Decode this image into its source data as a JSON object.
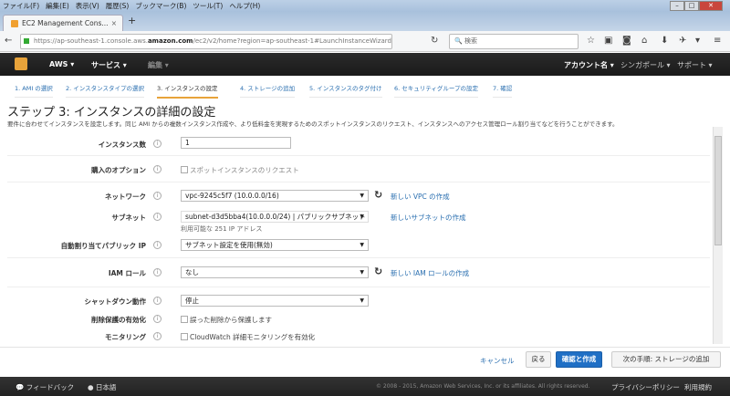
{
  "browser": {
    "menu": [
      "ファイル(F)",
      "編集(E)",
      "表示(V)",
      "履歴(S)",
      "ブックマーク(B)",
      "ツール(T)",
      "ヘルプ(H)"
    ],
    "tab_title": "EC2 Management Cons...",
    "url_prefix": "https://ap-southeast-1.console.aws.",
    "url_domain": "amazon.com",
    "url_suffix": "/ec2/v2/home?region=ap-southeast-1#LaunchInstanceWizard:",
    "search_placeholder": "検索"
  },
  "aws_nav": {
    "aws": "AWS ▾",
    "services": "サービス ▾",
    "edit": "編集 ▾",
    "account": "アカウント名 ▾",
    "region": "シンガポール ▾",
    "support": "サポート ▾"
  },
  "steps": [
    "1. AMI の選択",
    "2. インスタンスタイプの選択",
    "3. インスタンスの設定",
    "4. ストレージの追加",
    "5. インスタンスのタグ付け",
    "6. セキュリティグループの設定",
    "7. 確認"
  ],
  "page": {
    "title": "ステップ 3: インスタンスの詳細の設定",
    "description": "要件に合わせてインスタンスを設定します。同じ AMI からの複数インスタンス作成や、より低料金を実現するためのスポットインスタンスのリクエスト、インスタンスへのアクセス管理ロール割り当てなどを行うことができます。"
  },
  "form": {
    "instance_count": {
      "label": "インスタンス数",
      "value": "1"
    },
    "purchase": {
      "label": "購入のオプション",
      "checkbox": "スポットインスタンスのリクエスト",
      "checked": false
    },
    "network": {
      "label": "ネットワーク",
      "value": "vpc-9245c5f7 (10.0.0.0/16)",
      "link": "新しい VPC の作成"
    },
    "subnet": {
      "label": "サブネット",
      "value": "subnet-d3d5bba4(10.0.0.0/24) | パブリックサブネット",
      "note": "利用可能な 251 IP アドレス",
      "link": "新しいサブネットの作成"
    },
    "public_ip": {
      "label": "自動割り当てパブリック IP",
      "value": "サブネット設定を使用(無効)"
    },
    "iam": {
      "label": "IAM ロール",
      "value": "なし",
      "link": "新しい IAM ロールの作成"
    },
    "shutdown": {
      "label": "シャットダウン動作",
      "value": "停止"
    },
    "termination": {
      "label": "削除保護の有効化",
      "checkbox": "誤った削除から保護します",
      "checked": false
    },
    "monitoring": {
      "label": "モニタリング",
      "checkbox": "CloudWatch 詳細モニタリングを有効化",
      "checked": false
    }
  },
  "actions": {
    "cancel": "キャンセル",
    "back": "戻る",
    "review": "確認と作成",
    "next": "次の手順: ストレージの追加"
  },
  "footer": {
    "feedback": "フィードバック",
    "language": "日本語",
    "copyright": "© 2008 - 2015, Amazon Web Services, Inc. or its affiliates. All rights reserved.",
    "privacy": "プライバシーポリシー",
    "terms": "利用規約"
  },
  "colors": {
    "accent": "#e8a33a",
    "link": "#2a6fb0",
    "primary": "#1f6fc5"
  }
}
